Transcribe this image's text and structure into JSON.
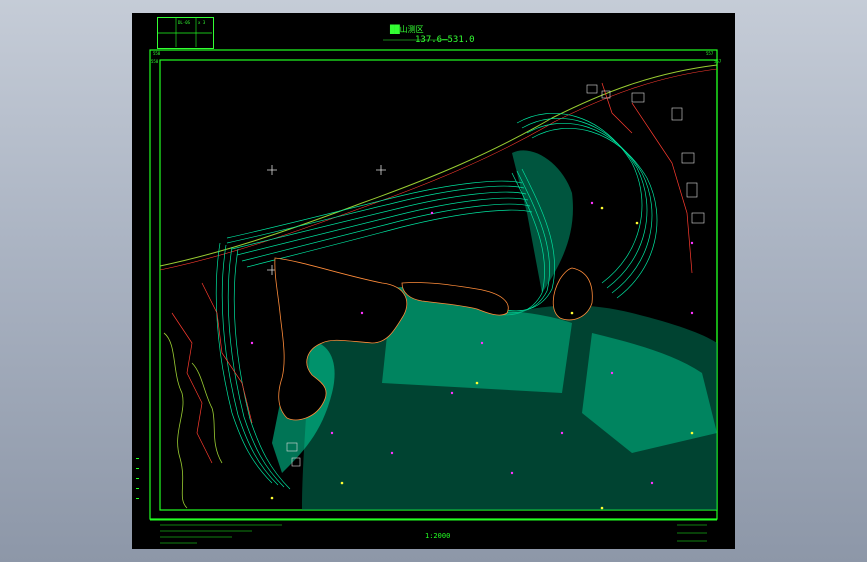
{
  "sheet": {
    "title": "██山测区",
    "range": "137.6—531.0",
    "scale": "1:2000"
  },
  "legend": {
    "cells": [
      "",
      "DL-0S",
      "x 3",
      "",
      "",
      "",
      "",
      ""
    ]
  },
  "corners": {
    "top_left": "558",
    "top_right": "557",
    "top_left2": "558",
    "top_right2": "557"
  },
  "notes": {
    "left": [
      "",
      "",
      "",
      ""
    ],
    "right": [
      "",
      "",
      ""
    ]
  },
  "colors": {
    "background": "#000000",
    "frame": "#22ff22",
    "contour": "#00e5a0",
    "roads": "#ff3b2f",
    "labels": "#ff33ff",
    "vegetation": "#9acd32"
  }
}
